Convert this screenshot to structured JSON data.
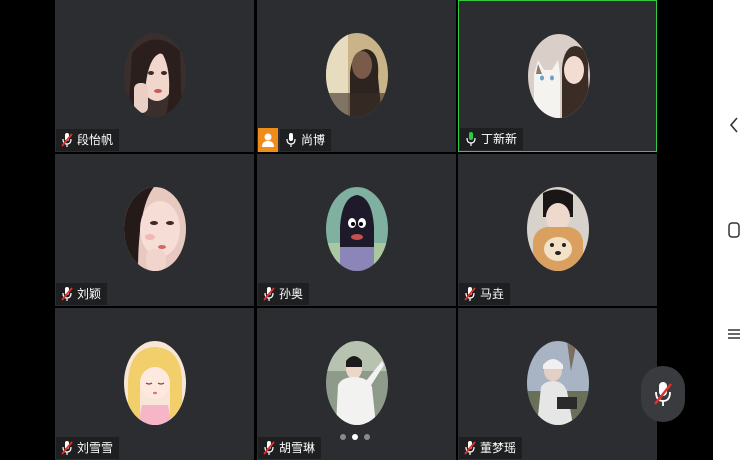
{
  "participants": [
    {
      "name": "段怡帆",
      "mic": "muted",
      "host": false,
      "active": false,
      "avatar": "girl-portrait-avatar"
    },
    {
      "name": "尚博",
      "mic": "on",
      "host": true,
      "active": false,
      "avatar": "window-silhouette-avatar"
    },
    {
      "name": "丁新新",
      "mic": "speaking",
      "host": false,
      "active": true,
      "avatar": "girl-with-cat-avatar"
    },
    {
      "name": "刘颖",
      "mic": "muted",
      "host": false,
      "active": false,
      "avatar": "girl-closeup-avatar"
    },
    {
      "name": "孙奥",
      "mic": "muted",
      "host": false,
      "active": false,
      "avatar": "cartoon-character-avatar"
    },
    {
      "name": "马垚",
      "mic": "muted",
      "host": false,
      "active": false,
      "avatar": "man-with-dog-avatar"
    },
    {
      "name": "刘雪雪",
      "mic": "muted",
      "host": false,
      "active": false,
      "avatar": "anime-girl-avatar"
    },
    {
      "name": "胡雪琳",
      "mic": "muted",
      "host": false,
      "active": false,
      "avatar": "girl-white-shirt-avatar"
    },
    {
      "name": "董梦瑶",
      "mic": "muted",
      "host": false,
      "active": false,
      "avatar": "person-outdoor-avatar"
    }
  ],
  "pagination": {
    "total_pages": 3,
    "current_page": 2
  },
  "colors": {
    "tile_bg": "#2b2d30",
    "active_border": "#2ecc40",
    "host_badge": "#f08c1a",
    "muted_red": "#e0312b",
    "speaking_green": "#2ecc40"
  },
  "system_nav": {
    "icons": [
      "back-icon",
      "home-icon",
      "recents-icon"
    ]
  }
}
